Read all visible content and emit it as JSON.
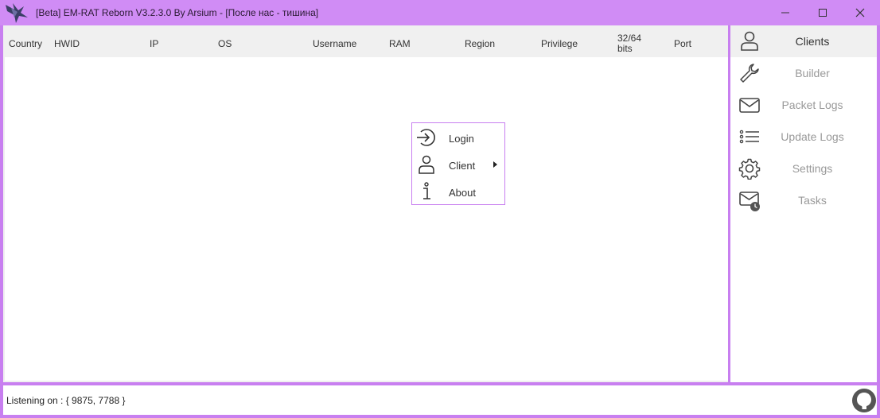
{
  "window": {
    "title": "[Beta] EM-RAT Reborn V3.2.3.0 By Arsium - [После нас - тишина]",
    "accent": "#d08cf5",
    "border": "#c87ff0"
  },
  "columns": [
    "Country",
    "HWID",
    "IP",
    "OS",
    "Username",
    "RAM",
    "Region",
    "Privilege",
    "32/64\nbits",
    "Port"
  ],
  "sidebar": {
    "items": [
      {
        "label": "Clients",
        "icon": "user-icon",
        "active": true
      },
      {
        "label": "Builder",
        "icon": "wrench-icon"
      },
      {
        "label": "Packet Logs",
        "icon": "envelope-icon"
      },
      {
        "label": "Update Logs",
        "icon": "list-icon"
      },
      {
        "label": "Settings",
        "icon": "gear-icon"
      },
      {
        "label": "Tasks",
        "icon": "envelope-clock-icon"
      }
    ]
  },
  "context_menu": {
    "items": [
      {
        "label": "Login",
        "icon": "login-arrow-icon"
      },
      {
        "label": "Client",
        "icon": "user-icon",
        "submenu": true
      },
      {
        "label": "About",
        "icon": "info-icon"
      }
    ]
  },
  "status": {
    "text": "Listening on : { 9875, 7788 }"
  }
}
